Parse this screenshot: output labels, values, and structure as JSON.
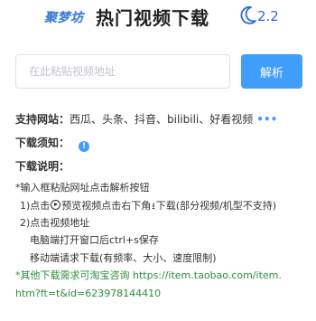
{
  "header": {
    "brand": "聚梦坊",
    "title": "热门视频下载",
    "version": "2.2",
    "title_color": "#222222",
    "brand_color": "#3d7fd8",
    "version_color": "#2b6bd6",
    "moon_icon": "crescent-moon-icon"
  },
  "input": {
    "placeholder": "在此粘贴视频地址",
    "value": ""
  },
  "parse_button": {
    "label": "解析",
    "color": "#409eff"
  },
  "supported": {
    "label": "支持网站：",
    "sites": "西瓜、头条、抖音、bilibili、好看视频",
    "more_icon": "more-dots-icon",
    "more_text": "•••"
  },
  "notice": {
    "label": "下载须知：",
    "icon": "info-icon",
    "icon_text": "!"
  },
  "description": {
    "label": "下载说明：",
    "line1": "*输入框粘贴网址点击解析按钮",
    "line2_a": "1)点击",
    "line2_b": "预览视频点击右下角",
    "line2_c": "下载(部分视频/机型不支持)",
    "download_icon_text": "⭳",
    "line3": "2)点击视频地址",
    "line4": "电脑端打开窗口后ctrl+s保存",
    "line5": "移动端请求下载(有频率、大小、速度限制)",
    "line6": "*其他下载需求可淘宝咨询 https://item.taobao.com/item.",
    "line7": "htm?ft=t&id=623978144410",
    "accent_color": "#2d8f3a"
  }
}
